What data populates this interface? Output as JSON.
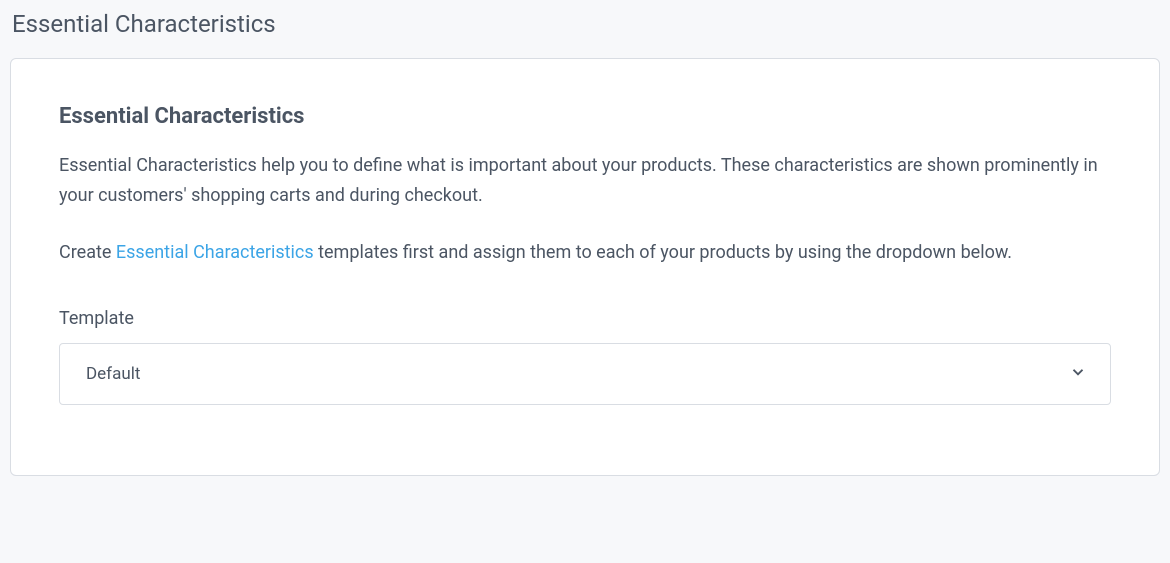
{
  "section": {
    "title": "Essential Characteristics"
  },
  "card": {
    "title": "Essential Characteristics",
    "description_p1": "Essential Characteristics help you to define what is important about your products. These characteristics are shown prominently in your customers' shopping carts and during checkout.",
    "description_p2_prefix": "Create ",
    "description_p2_link": "Essential Characteristics",
    "description_p2_suffix": " templates first and assign them to each of your products by using the dropdown below."
  },
  "template": {
    "label": "Template",
    "selected": "Default"
  }
}
